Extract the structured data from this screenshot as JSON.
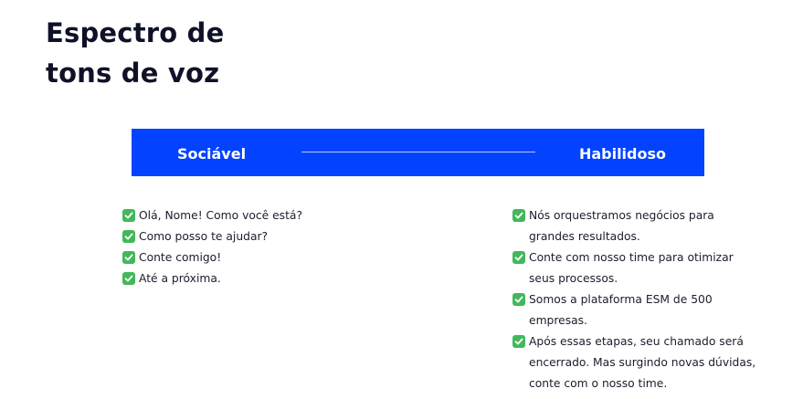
{
  "title": {
    "line1": "Espectro de",
    "line2": "tons de voz"
  },
  "spectrum": {
    "left_label": "Sociável",
    "right_label": "Habilidoso",
    "bar_color": "#0343ff"
  },
  "social_phrases": [
    "Olá, Nome! Como você está?",
    "Como posso te ajudar?",
    "Conte comigo!",
    "Até a próxima."
  ],
  "skilled_phrases": [
    {
      "line1": "Nós orquestramos negócios para",
      "line2": "grandes resultados."
    },
    {
      "line1": "Conte com nosso time para otimizar",
      "line2": "seus processos."
    },
    {
      "line1": "Somos a plataforma ESM de 500",
      "line2": "empresas."
    },
    {
      "line1": "Após essas etapas, seu chamado será",
      "line2": "encerrado. Mas surgindo novas dúvidas,",
      "line3": "conte com o nosso time."
    }
  ],
  "icons": {
    "check": "check-mark-button-icon",
    "check_color": "#42b85b"
  }
}
